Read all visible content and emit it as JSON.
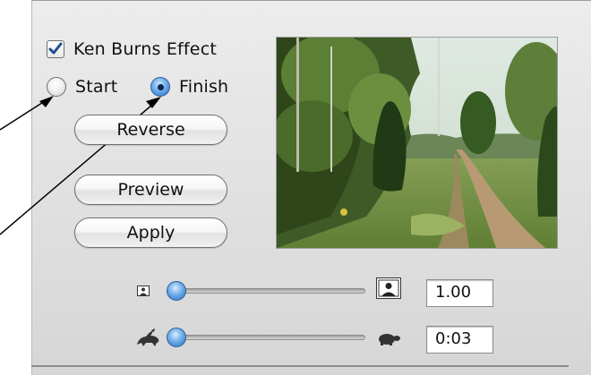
{
  "ken_burns": {
    "label": "Ken Burns Effect",
    "checked": true
  },
  "position": {
    "start_label": "Start",
    "finish_label": "Finish",
    "selected": "Finish"
  },
  "buttons": {
    "reverse": "Reverse",
    "preview": "Preview",
    "apply": "Apply"
  },
  "zoom": {
    "value": "1.00",
    "min_icon": "small-photo-icon",
    "max_icon": "large-photo-icon",
    "slider_fraction": 0.0
  },
  "duration": {
    "value": "0:03",
    "min_icon": "rabbit-icon",
    "max_icon": "turtle-icon",
    "slider_fraction": 0.0
  },
  "colors": {
    "accent": "#2c6bc2",
    "panel": "#e3e3e3"
  }
}
